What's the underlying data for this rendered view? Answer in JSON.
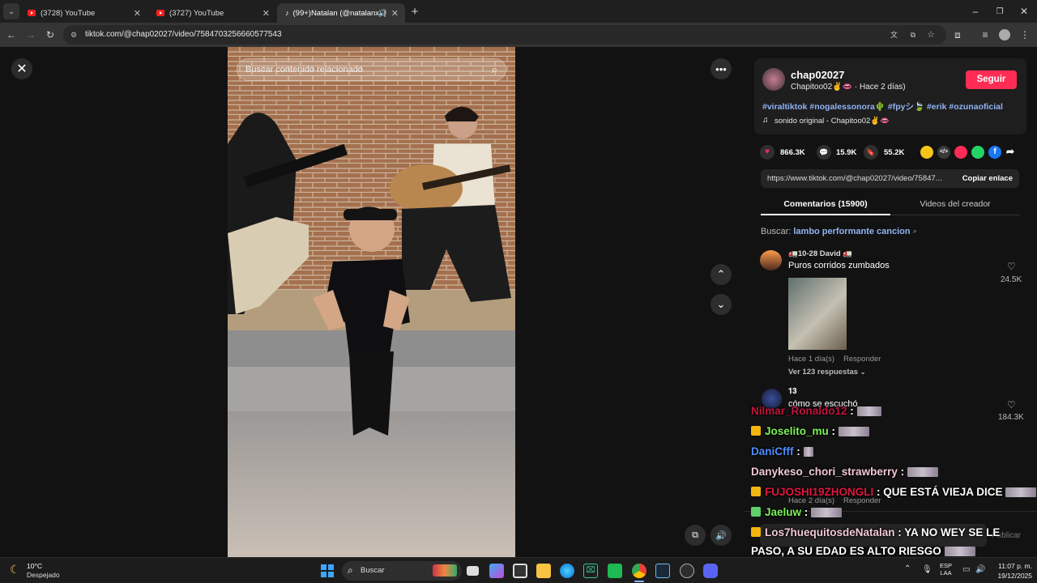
{
  "browser": {
    "tabs": [
      {
        "title": "(3728) YouTube",
        "favicon": "youtube-icon"
      },
      {
        "title": "(3727) YouTube",
        "favicon": "youtube-icon"
      },
      {
        "title": "(99+)Natalan (@natalanx) |",
        "favicon": "tiktok-icon",
        "active": true
      }
    ],
    "new_tab_label": "+",
    "url": "tiktok.com/@chap02027/video/7584703256660577543"
  },
  "video_page": {
    "search_placeholder": "Buscar contenido relacionado"
  },
  "creator": {
    "username": "chap02027",
    "display_line": "Chapitoo02✌️👄 · Hace 2 días)",
    "follow_label": "Seguir"
  },
  "description": {
    "hashtags": "#viraltiktok #nogalessonora🌵 #fpyシ🍃 #erik #ozunaoficial",
    "sound": "sonido original - Chapitoo02✌️👄"
  },
  "stats": {
    "likes": "866.3K",
    "comments": "15.9K",
    "saves": "55.2K"
  },
  "share": {
    "link": "https://www.tiktok.com/@chap02027/video/75847...",
    "copy_label": "Copiar enlace"
  },
  "tabs": {
    "comments": "Comentarios (15900)",
    "creator_videos": "Videos del creador"
  },
  "search_suggestion": {
    "prefix": "Buscar:",
    "query": "lambo performante cancion"
  },
  "comments": [
    {
      "user": "🚛10-28 David 🚛",
      "text": "Puros corridos zumbados",
      "likes": "24.5K",
      "time": "Hace 1 día(s)",
      "reply": "Responder",
      "view_replies": "Ver 123 respuestas"
    },
    {
      "user": "𝟏𝟑",
      "text": "cómo se escuchó",
      "likes": "184.3K",
      "time": "Hace 2 día(s)",
      "reply": "Responder"
    }
  ],
  "overlay_chat": [
    {
      "name": "Nilmar_Ronaldo12",
      "color": "#c3123c",
      "text": "",
      "crown": false
    },
    {
      "name": "Joselito_mu",
      "color": "#7cf25a",
      "text": "",
      "crown": true
    },
    {
      "name": "DaniCfff",
      "color": "#4f8cff",
      "text": "",
      "crown": false
    },
    {
      "name": "Danykeso_chori_strawberry",
      "color": "#f2c9d6",
      "text": "",
      "crown": false
    },
    {
      "name": "FUJOSHI19ZHONGLI",
      "color": "#e0173d",
      "text": "QUE ESTÁ VIEJA DICE",
      "crown": true
    },
    {
      "name": "Jaeluw",
      "color": "#7cf25a",
      "text": "",
      "crown": true
    },
    {
      "name": "Los7huequitosdeNatalan",
      "color": "#f2c9d6",
      "text": "YA NO WEY SE LE",
      "crown": true
    },
    {
      "name": "",
      "color": "#ffffff",
      "text": "PASO, A SU EDAD ES ALTO RIESGO",
      "crown": false
    }
  ],
  "comment_input_placeholder": "Publicar",
  "taskbar": {
    "weather_temp": "10°C",
    "weather_desc": "Despejado",
    "search_label": "Buscar",
    "lang_top": "ESP",
    "lang_bottom": "LAA",
    "time": "11:07 p. m.",
    "date": "19/12/2025"
  }
}
